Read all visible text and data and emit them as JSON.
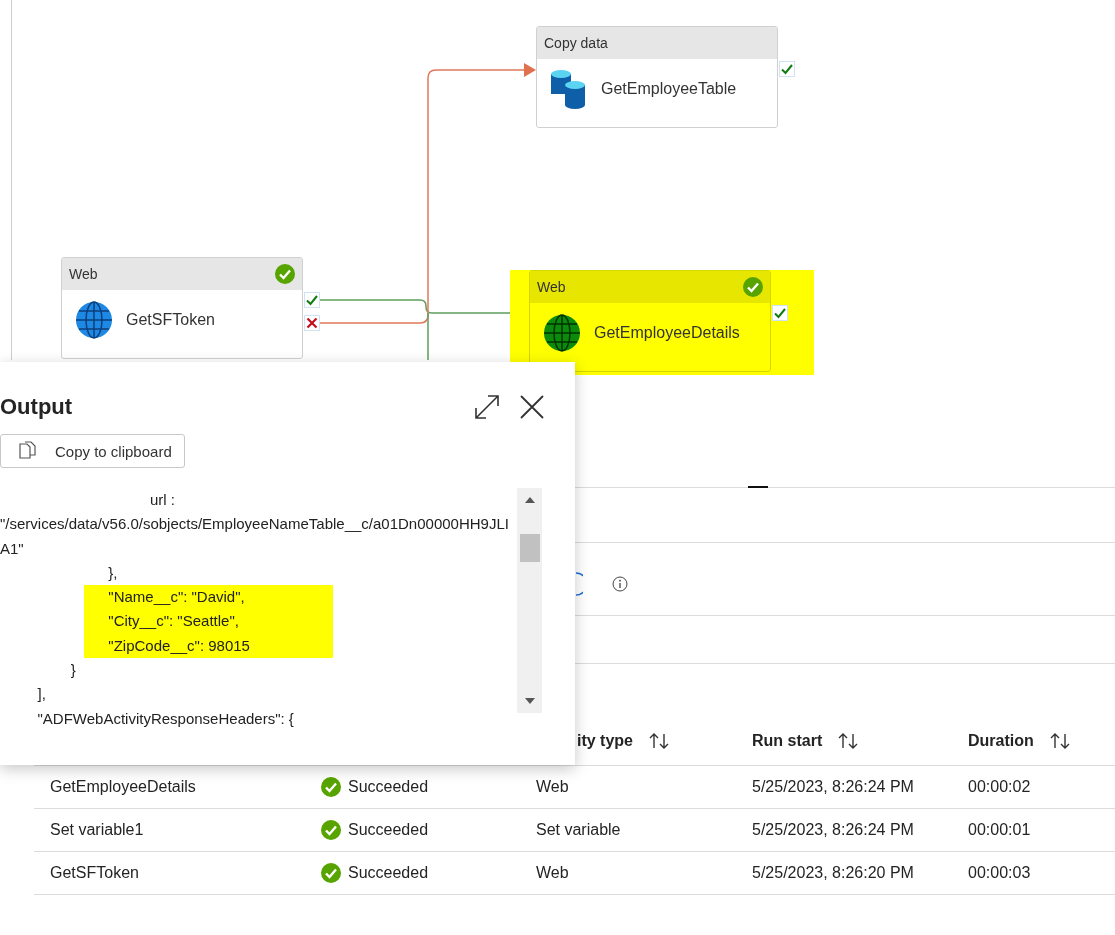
{
  "canvas": {
    "nodes": [
      {
        "type": "Copy data",
        "name": "GetEmployeeTable",
        "kind": "copy",
        "succeeded": false,
        "highlighted": false,
        "ports": [
          {
            "kind": "success"
          }
        ]
      },
      {
        "type": "Web",
        "name": "GetSFToken",
        "kind": "web",
        "succeeded": true,
        "highlighted": false,
        "ports": [
          {
            "kind": "success"
          },
          {
            "kind": "failure"
          }
        ]
      },
      {
        "type": "Web",
        "name": "GetEmployeeDetails",
        "kind": "web",
        "succeeded": true,
        "highlighted": true,
        "ports": [
          {
            "kind": "success"
          }
        ]
      }
    ]
  },
  "output_dialog": {
    "title": "Output",
    "copy_button": "Copy to clipboard",
    "lines": [
      {
        "text": "                                    url :",
        "highlighted": false
      },
      {
        "text": "\"/services/data/v56.0/sobjects/EmployeeNameTable__c/a01Dn00000HH9JLIA1\"",
        "highlighted": false
      },
      {
        "text": "                          },",
        "highlighted": false
      },
      {
        "text": "                          \"Name__c\": \"David\",",
        "highlighted": true
      },
      {
        "text": "                          \"City__c\": \"Seattle\",",
        "highlighted": true
      },
      {
        "text": "                          \"ZipCode__c\": 98015",
        "highlighted": true
      },
      {
        "text": "                 }",
        "highlighted": false
      },
      {
        "text": "         ],",
        "highlighted": false
      },
      {
        "text": "         \"ADFWebActivityResponseHeaders\": {",
        "highlighted": false
      }
    ]
  },
  "activity_runs": {
    "columns": [
      {
        "label": "ity type"
      },
      {
        "label": "Run start"
      },
      {
        "label": "Duration"
      }
    ],
    "rows": [
      {
        "name": "GetEmployeeDetails",
        "status": "Succeeded",
        "succeeded": true,
        "type": "Web",
        "run_start": "5/25/2023, 8:26:24 PM",
        "duration": "00:00:02"
      },
      {
        "name": "Set variable1",
        "status": "Succeeded",
        "succeeded": true,
        "type": "Set variable",
        "run_start": "5/25/2023, 8:26:24 PM",
        "duration": "00:00:01"
      },
      {
        "name": "GetSFToken",
        "status": "Succeeded",
        "succeeded": true,
        "type": "Web",
        "run_start": "5/25/2023, 8:26:20 PM",
        "duration": "00:00:03"
      }
    ]
  }
}
